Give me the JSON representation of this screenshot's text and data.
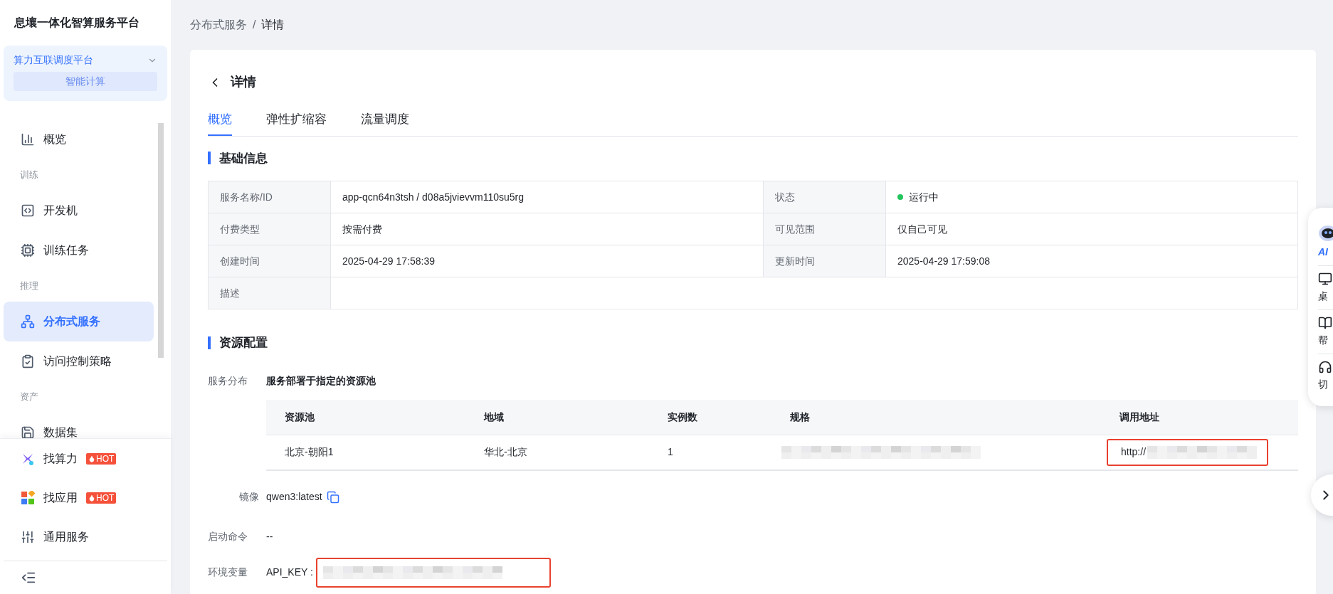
{
  "sidebar": {
    "title": "息壤一体化智算服务平台",
    "platform": {
      "name": "算力互联调度平台",
      "badge": "智能计算"
    },
    "items": [
      {
        "kind": "item",
        "label": "概览",
        "selected": false
      },
      {
        "kind": "section",
        "label": "训练"
      },
      {
        "kind": "item",
        "label": "开发机",
        "selected": false
      },
      {
        "kind": "item",
        "label": "训练任务",
        "selected": false
      },
      {
        "kind": "section",
        "label": "推理"
      },
      {
        "kind": "item",
        "label": "分布式服务",
        "selected": true
      },
      {
        "kind": "item",
        "label": "访问控制策略",
        "selected": false
      },
      {
        "kind": "section",
        "label": "资产"
      },
      {
        "kind": "item",
        "label": "数据集",
        "selected": false
      }
    ],
    "bottom_items": [
      {
        "label": "找算力",
        "badge": "HOT"
      },
      {
        "label": "找应用",
        "badge": "HOT"
      },
      {
        "label": "通用服务"
      }
    ]
  },
  "breadcrumb": {
    "items": [
      "分布式服务",
      "详情"
    ],
    "separator": "/"
  },
  "page_title": "详情",
  "tabs": [
    {
      "label": "概览",
      "selected": true
    },
    {
      "label": "弹性扩缩容",
      "selected": false
    },
    {
      "label": "流量调度",
      "selected": false
    }
  ],
  "basic_info": {
    "title": "基础信息",
    "rows": [
      [
        {
          "label": "服务名称/ID",
          "value": "app-qcn64n3tsh / d08a5jvievvm110su5rg"
        },
        {
          "label": "状态",
          "value": "运行中",
          "color": "#22c55e"
        }
      ],
      [
        {
          "label": "付费类型",
          "value": "按需付费"
        },
        {
          "label": "可见范围",
          "value": "仅自己可见"
        }
      ],
      [
        {
          "label": "创建时间",
          "value": "2025-04-29 17:58:39"
        },
        {
          "label": "更新时间",
          "value": "2025-04-29 17:59:08"
        }
      ],
      [
        {
          "label": "描述"
        }
      ]
    ]
  },
  "resources": {
    "title": "资源配置",
    "distribution_label": "服务分布",
    "distribution_value": "服务部署于指定的资源池",
    "table": {
      "columns": [
        "资源池",
        "地域",
        "实例数",
        "规格",
        "调用地址"
      ],
      "rows": [
        {
          "pool": "北京-朝阳1",
          "region": "华北-北京",
          "instances": "1",
          "address_prefix": "http://"
        }
      ]
    },
    "image_label": "镜像",
    "image_value": "qwen3:latest",
    "command_label": "启动命令",
    "command_value": "--",
    "env_label": "环境变量",
    "env_value": "API_KEY :"
  },
  "float_panel": {
    "items": [
      "AI",
      "桌",
      "帮",
      "切"
    ]
  }
}
